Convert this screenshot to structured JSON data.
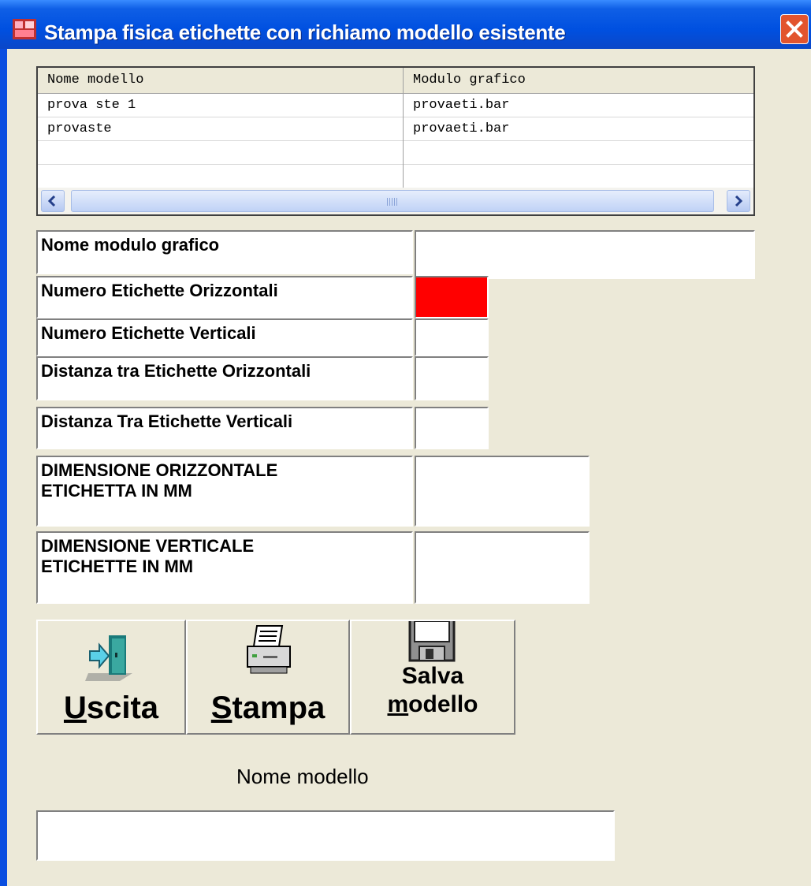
{
  "window": {
    "title": "Stampa fisica etichette  con richiamo modello esistente"
  },
  "grid": {
    "columns": [
      "Nome modello",
      "Modulo grafico"
    ],
    "rows": [
      [
        "prova ste 1",
        "provaeti.bar"
      ],
      [
        "provaste",
        "provaeti.bar"
      ]
    ]
  },
  "fields": {
    "nome_modulo": "Nome modulo grafico",
    "num_orizz": "Numero Etichette Orizzontali",
    "num_vert": "Numero Etichette Verticali",
    "dist_orizz": "Distanza tra Etichette Orizzontali",
    "dist_vert": "Distanza Tra Etichette Verticali",
    "dim_orizz_l1": "DIMENSIONE ORIZZONTALE",
    "dim_orizz_l2": "ETICHETTA IN MM",
    "dim_vert_l1": "DIMENSIONE VERTICALE",
    "dim_vert_l2": "ETICHETTE IN MM"
  },
  "buttons": {
    "uscita_u": "U",
    "uscita_rest": "scita",
    "stampa_u": "S",
    "stampa_rest": "tampa",
    "salva_l1": "Salva",
    "salva_u": "m",
    "salva_rest": "odello"
  },
  "bottom": {
    "label": "Nome modello"
  },
  "colors": {
    "invalid_field": "#ff0000"
  }
}
